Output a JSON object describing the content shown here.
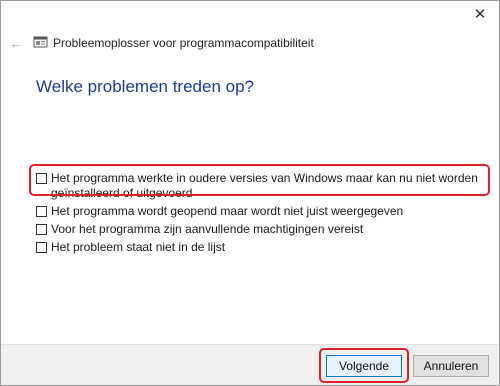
{
  "window": {
    "title": "Probleemoplosser voor programmacompatibiliteit",
    "close_icon": "close-icon",
    "back_icon": "back-arrow-icon",
    "app_icon": "troubleshooter-icon"
  },
  "page": {
    "heading": "Welke problemen treden op?"
  },
  "options": [
    {
      "label": "Het programma werkte in oudere versies van Windows maar kan nu niet worden geïnstalleerd of uitgevoerd",
      "checked": false
    },
    {
      "label": "Het programma wordt geopend maar wordt niet juist weergegeven",
      "checked": false
    },
    {
      "label": "Voor het programma zijn aanvullende machtigingen vereist",
      "checked": false
    },
    {
      "label": "Het probleem staat niet in de lijst",
      "checked": false
    }
  ],
  "footer": {
    "next_label": "Volgende",
    "cancel_label": "Annuleren"
  },
  "colors": {
    "heading": "#1b3d94",
    "highlight": "#e0202a",
    "default_button_border": "#0078d7"
  }
}
